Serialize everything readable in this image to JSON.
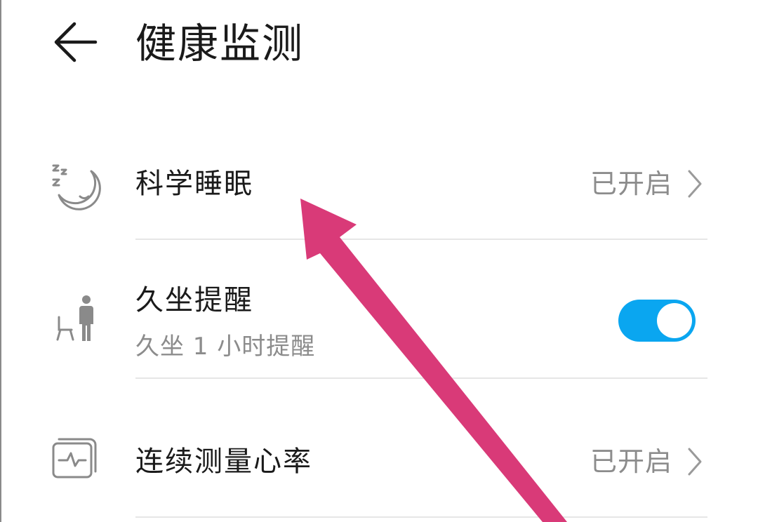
{
  "header": {
    "back_icon": "arrow-left-icon",
    "title": "健康监测"
  },
  "items": [
    {
      "icon": "sleep-moon-icon",
      "title": "科学睡眠",
      "status": "已开启",
      "chevron_icon": "chevron-right-icon"
    },
    {
      "icon": "sitting-person-icon",
      "title": "久坐提醒",
      "subtitle": "久坐 1 小时提醒",
      "toggle_on": true
    },
    {
      "icon": "heart-rate-monitor-icon",
      "title": "连续测量心率",
      "status": "已开启",
      "chevron_icon": "chevron-right-icon"
    }
  ],
  "colors": {
    "toggle_on": "#0aa6f0",
    "annotation_arrow": "#d93a78",
    "icon_gray": "#8a8a8a"
  }
}
